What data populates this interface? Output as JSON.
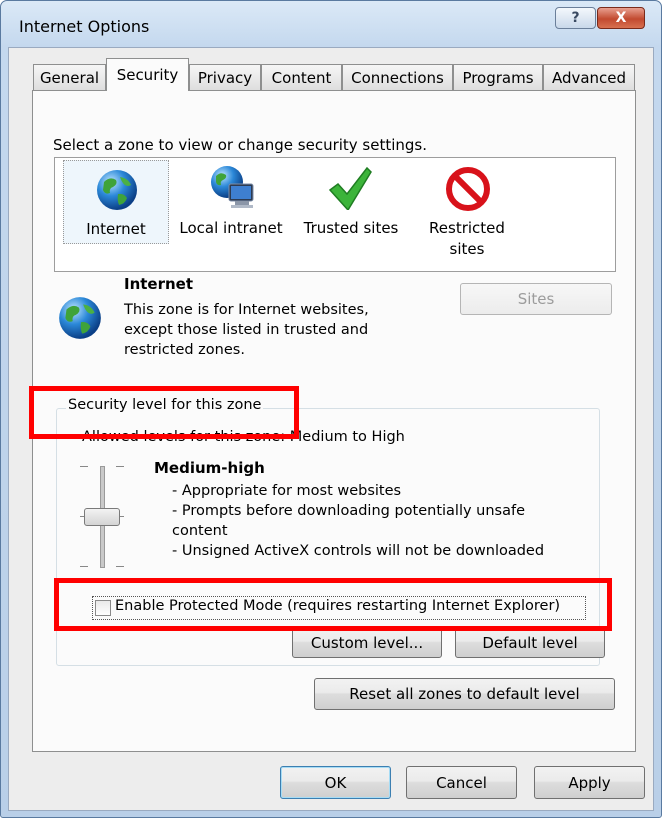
{
  "window": {
    "title": "Internet Options",
    "help_glyph": "?",
    "close_glyph": "X"
  },
  "tabs": [
    "General",
    "Security",
    "Privacy",
    "Content",
    "Connections",
    "Programs",
    "Advanced"
  ],
  "security": {
    "instruction": "Select a zone to view or change security settings.",
    "zones": [
      {
        "label_line1": "Internet",
        "label_line2": "",
        "icon": "globe-icon"
      },
      {
        "label_line1": "Local intranet",
        "label_line2": "",
        "icon": "intranet-icon"
      },
      {
        "label_line1": "Trusted sites",
        "label_line2": "",
        "icon": "checkmark-icon"
      },
      {
        "label_line1": "Restricted",
        "label_line2": "sites",
        "icon": "restricted-icon"
      }
    ],
    "selected_zone": {
      "name": "Internet",
      "desc1": "This zone is for Internet websites,",
      "desc2": "except those listed in trusted and",
      "desc3": "restricted zones."
    },
    "sites_button": {
      "label": "Sites",
      "enabled": false
    },
    "level_group_title": "Security level for this zone",
    "allowed_levels": "Allowed levels for this zone: Medium to High",
    "level_name": "Medium-high",
    "level_points": [
      "- Appropriate for most websites",
      "- Prompts before downloading potentially unsafe",
      "content",
      "- Unsigned ActiveX controls will not be downloaded"
    ],
    "protected_mode": {
      "label": "Enable Protected Mode (requires restarting Internet Explorer)",
      "checked": false
    },
    "custom_level_button": "Custom level...",
    "default_level_button": "Default level",
    "reset_all_button": "Reset all zones to default level"
  },
  "footer": {
    "ok": "OK",
    "cancel": "Cancel",
    "apply": "Apply"
  },
  "colors": {
    "highlight_box": "#ff0000",
    "accent": "#3c7fb1"
  }
}
